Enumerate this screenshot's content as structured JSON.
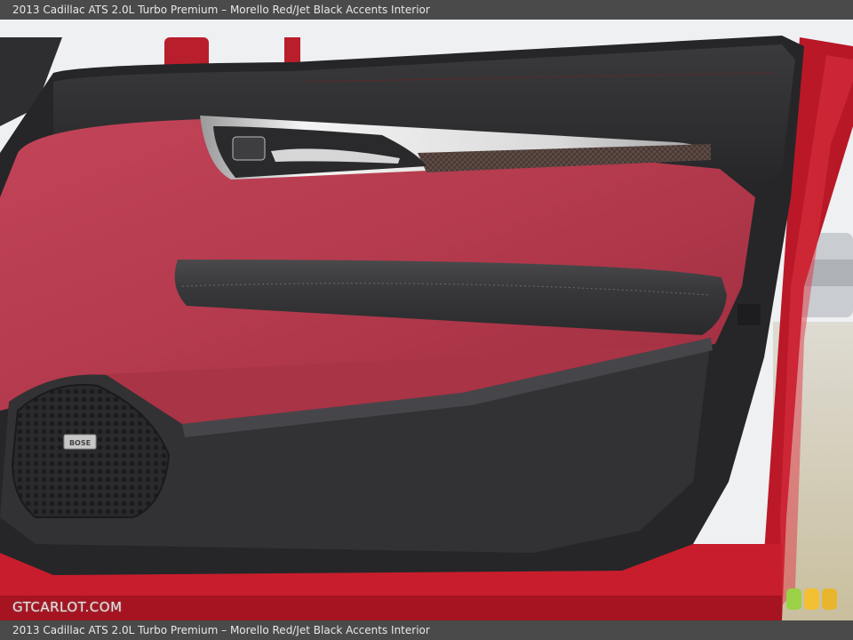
{
  "caption": "2013 Cadillac ATS 2.0L Turbo Premium – Morello Red/Jet Black Accents Interior",
  "watermark": "GTCARLOT.COM",
  "speaker_badge": "BOSE",
  "colors": {
    "paint_red": "#c8202e",
    "leather_red": "#b73a4c",
    "trim_black": "#2b2b2d",
    "caption_bar": "#4a4a4a"
  },
  "bubble_colors": [
    "#9ad147",
    "#f2c033",
    "#e8b62c"
  ]
}
